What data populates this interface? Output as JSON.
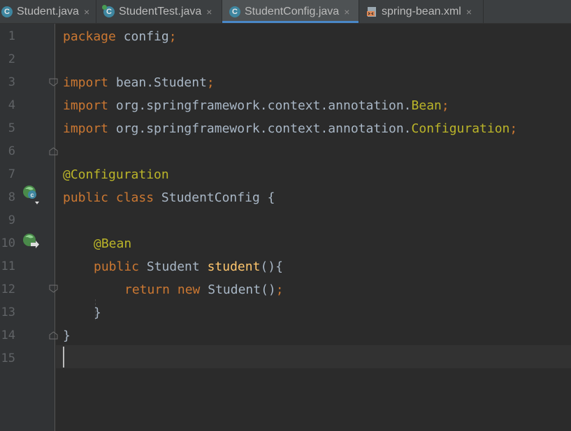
{
  "tabs": [
    {
      "label": "Student.java",
      "icon": "class-icon",
      "active": false
    },
    {
      "label": "StudentTest.java",
      "icon": "test-class-icon",
      "active": false
    },
    {
      "label": "StudentConfig.java",
      "icon": "class-icon",
      "active": true
    },
    {
      "label": "spring-bean.xml",
      "icon": "xml-file-icon",
      "active": false
    }
  ],
  "tab_close_symbol": "×",
  "class_icon_letter": "C",
  "line_numbers": [
    "1",
    "2",
    "3",
    "4",
    "5",
    "6",
    "7",
    "8",
    "9",
    "10",
    "11",
    "12",
    "13",
    "14",
    "15"
  ],
  "code": {
    "l1": {
      "kw": "package",
      "rest": " config",
      "semi": ";"
    },
    "l3": {
      "kw": "import",
      "rest": " bean.Student",
      "semi": ";"
    },
    "l4": {
      "kw": "import",
      "rest": " org.springframework.context.annotation.",
      "ann": "Bean",
      "semi": ";"
    },
    "l5": {
      "kw": "import",
      "rest": " org.springframework.context.annotation.",
      "ann": "Configuration",
      "semi": ";"
    },
    "l7": {
      "ann": "@Configuration"
    },
    "l8": {
      "kw1": "public",
      "kw2": " class",
      "rest": " StudentConfig {"
    },
    "l10": {
      "ann": "@Bean"
    },
    "l11": {
      "kw": "public",
      "type": " Student",
      "fn": " student",
      "rest": "(){"
    },
    "l12": {
      "kw1": "return",
      "kw2": " new",
      "rest": " Student()",
      "semi": ";"
    },
    "l13": {
      "rest": "}"
    },
    "l14": {
      "rest": "}"
    }
  },
  "colors": {
    "background": "#2b2b2b",
    "keyword": "#cc7832",
    "annotation": "#bbb529",
    "method": "#ffc66d",
    "text": "#a9b7c6",
    "active_tab_underline": "#4a88c7"
  }
}
